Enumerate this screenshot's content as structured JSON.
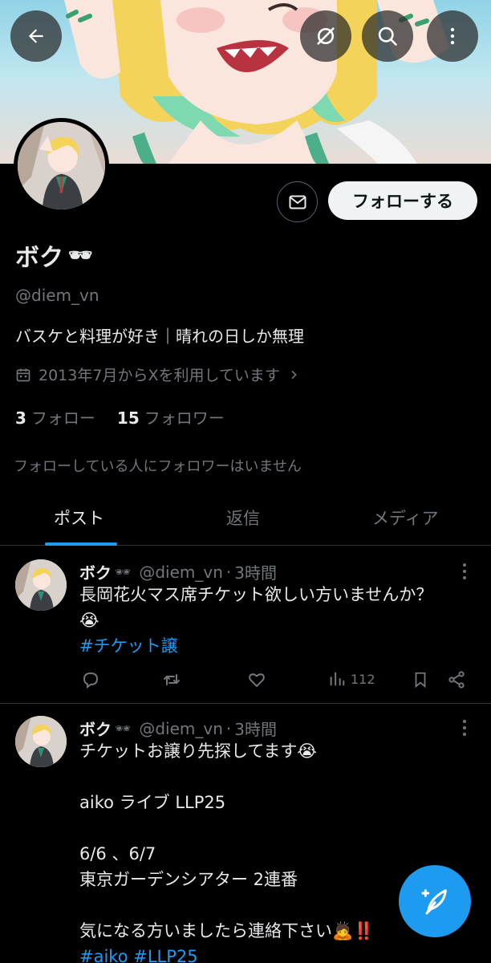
{
  "profile": {
    "name": "ボク",
    "name_emoji": "🕶",
    "handle": "@diem_vn",
    "bio": "バスケと料理が好き｜晴れの日しか無理",
    "joined": "2013年7月からXを利用しています",
    "following_count": "3",
    "following_label": "フォロー",
    "followers_count": "15",
    "followers_label": "フォロワー",
    "no_mutual": "フォローしている人にフォロワーはいません",
    "follow_button": "フォローする"
  },
  "tabs": [
    {
      "label": "ポスト",
      "active": true
    },
    {
      "label": "返信",
      "active": false
    },
    {
      "label": "メディア",
      "active": false
    }
  ],
  "posts": [
    {
      "name": "ボク",
      "name_emoji": "🕶",
      "handle": "@diem_vn",
      "sep": "·",
      "time": "3時間",
      "lines": [
        "長岡花火マス席チケット欲しい方いませんか？",
        "😭"
      ],
      "tags": "#チケット譲",
      "views": "112"
    },
    {
      "name": "ボク",
      "name_emoji": "🕶",
      "handle": "@diem_vn",
      "sep": "·",
      "time": "3時間",
      "lines": [
        "チケットお譲り先探してます😭",
        "",
        "aiko ライブ LLP25",
        "",
        "6/6 、6/7",
        "東京ガーデンシアター 2連番",
        "",
        "気になる方いましたら連絡下さい🙇‼️"
      ],
      "tags": "#aiko #LLP25"
    }
  ],
  "icons": {
    "back": "arrow-left-icon",
    "hide": "eye-off-icon",
    "search": "search-icon",
    "more": "more-vertical-icon",
    "message": "envelope-icon",
    "calendar": "calendar-icon",
    "reply": "reply-icon",
    "repost": "repost-icon",
    "like": "heart-icon",
    "views": "views-chart-icon",
    "bookmark": "bookmark-icon",
    "share": "share-icon",
    "compose": "compose-quill-icon"
  },
  "colors": {
    "accent": "#1d9bf0",
    "background": "#000000",
    "secondary_text": "#71767b"
  }
}
